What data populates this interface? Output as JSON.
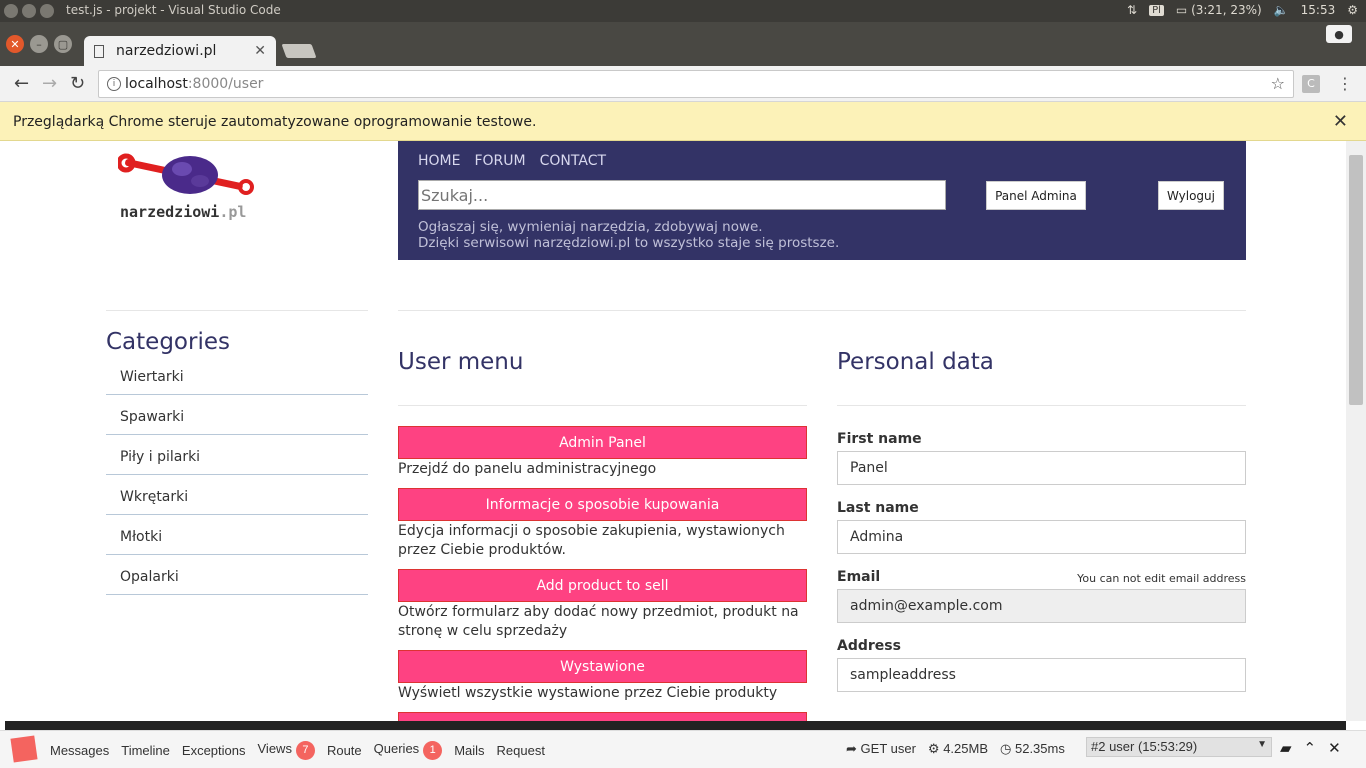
{
  "os": {
    "window_title": "test.js - projekt - Visual Studio Code",
    "kbd": "Pl",
    "battery": "(3:21, 23%)",
    "clock": "15:53"
  },
  "browser": {
    "tab_title": "narzedziowi.pl",
    "url_host": "localhost",
    "url_rest": ":8000/user",
    "infobar_message": "Przeglądarką Chrome steruje zautomatyzowane oprogramowanie testowe.",
    "ext_label": "C"
  },
  "site": {
    "logo_word": "narzedziowi",
    "logo_tld": ".pl",
    "nav": [
      "HOME",
      "FORUM",
      "CONTACT"
    ],
    "search_placeholder": "Szukaj...",
    "admin_button": "Panel Admina",
    "logout_button": "Wyloguj",
    "tagline_1": "Ogłaszaj się, wymieniaj narzędzia, zdobywaj nowe.",
    "tagline_2": "Dzięki serwisowi narzędziowi.pl to wszystko staje się prostsze."
  },
  "categories": {
    "title": "Categories",
    "items": [
      "Wiertarki",
      "Spawarki",
      "Piły i pilarki",
      "Wkrętarki",
      "Młotki",
      "Opalarki"
    ]
  },
  "user_menu": {
    "title": "User menu",
    "entries": [
      {
        "label": "Admin Panel",
        "desc": "Przejdź do panelu administracyjnego"
      },
      {
        "label": "Informacje o sposobie kupowania",
        "desc": "Edycja informacji o sposobie zakupienia, wystawionych przez Ciebie produktów."
      },
      {
        "label": "Add product to sell",
        "desc": "Otwórz formularz aby dodać nowy przedmiot, produkt na stronę w celu sprzedaży"
      },
      {
        "label": "Wystawione",
        "desc": "Wyświetl wszystkie wystawione przez Ciebie produkty"
      }
    ]
  },
  "personal_data": {
    "title": "Personal data",
    "first_name_label": "First name",
    "first_name": "Panel",
    "last_name_label": "Last name",
    "last_name": "Admina",
    "email_label": "Email",
    "email_note": "You can not edit email address",
    "email": "admin@example.com",
    "address_label": "Address",
    "address": "sampleaddress"
  },
  "debugbar": {
    "tabs": [
      "Messages",
      "Timeline",
      "Exceptions",
      "Views",
      "Route",
      "Queries",
      "Mails",
      "Request"
    ],
    "views_count": "7",
    "queries_count": "1",
    "route": "GET user",
    "memory": "4.25MB",
    "time": "52.35ms",
    "request_select": "#2 user (15:53:29)"
  }
}
